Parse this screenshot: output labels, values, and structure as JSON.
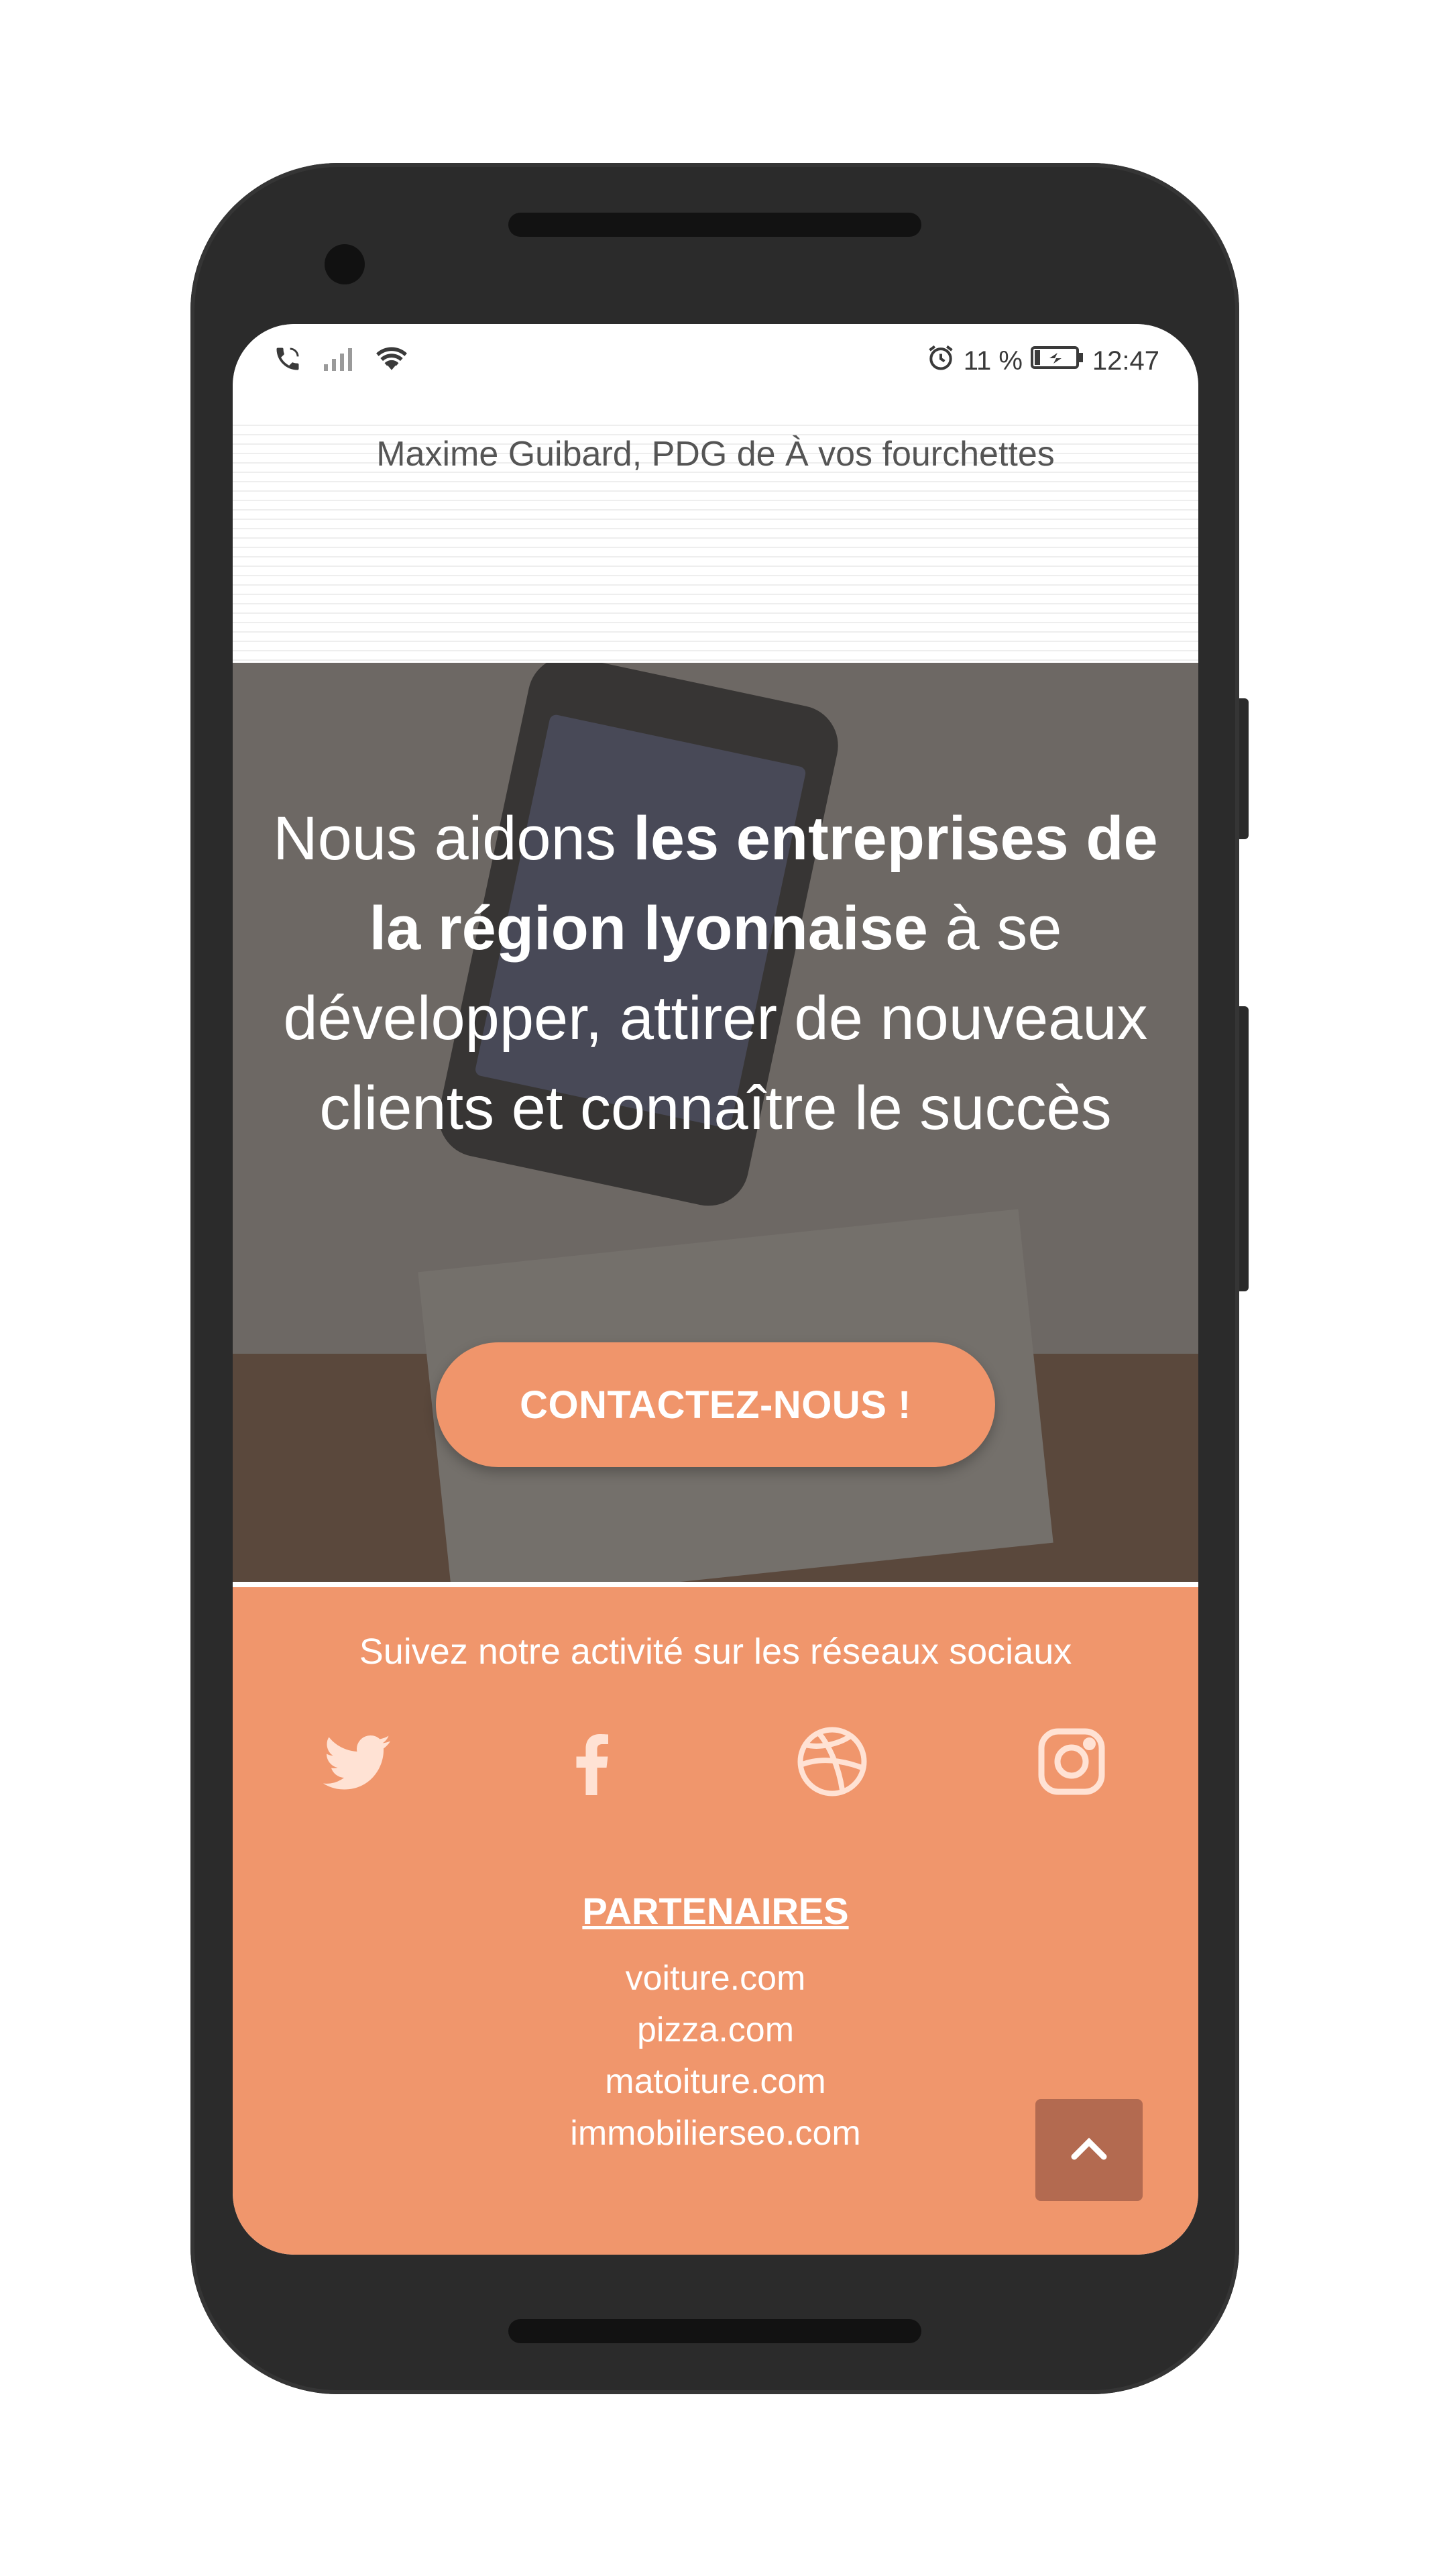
{
  "status_bar": {
    "alarm_icon": "alarm-icon",
    "battery_percent": "11 %",
    "time": "12:47"
  },
  "testimonial": {
    "author": "Maxime Guibard, PDG de À vos fourchettes"
  },
  "hero": {
    "headline_part1": "Nous aidons ",
    "headline_bold": "les entreprises de la région lyonnaise",
    "headline_part2": " à se développer, attirer de nouveaux clients et connaître le succès",
    "cta_label": "CONTACTEZ-NOUS !"
  },
  "footer": {
    "social_title": "Suivez notre activité sur les réseaux sociaux",
    "social_icons": [
      "twitter-icon",
      "facebook-icon",
      "dribbble-icon",
      "instagram-icon"
    ],
    "partners_title": "PARTENAIRES",
    "partners": [
      "voiture.com",
      "pizza.com",
      "matoiture.com",
      "immobilierseo.com"
    ],
    "scroll_top_icon": "chevron-up-icon"
  },
  "colors": {
    "accent": "#f0966c",
    "scroll_top_bg": "#b36a50",
    "phone_frame": "#2b2b2b"
  }
}
